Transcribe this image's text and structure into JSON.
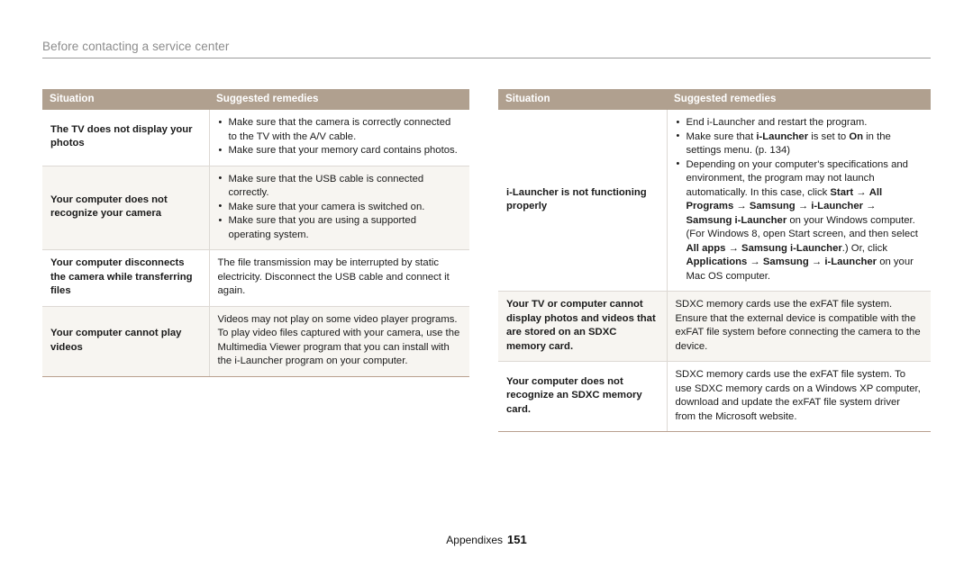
{
  "running_head": {
    "title": "Before contacting a service center"
  },
  "footer": {
    "section": "Appendixes",
    "page_number": "151"
  },
  "colors": {
    "table_header_bg": "#b0a08f",
    "table_header_text": "#ffffff",
    "row_shade": "#f7f5f1",
    "row_border": "#ddd9d4",
    "table_bottom_border": "#b99f8e",
    "running_head_text": "#8c8c8c",
    "running_head_rule": "#9a9a9a"
  },
  "tables": [
    {
      "id": "left",
      "columns": [
        "Situation",
        "Suggested remedies"
      ],
      "rows": [
        {
          "shaded": false,
          "situation": "The TV does not display your photos",
          "remedy_type": "bullets",
          "remedies": [
            "Make sure that the camera is correctly connected to the TV with the A/V cable.",
            "Make sure that your memory card contains photos."
          ]
        },
        {
          "shaded": true,
          "situation": "Your computer does not recognize your camera",
          "remedy_type": "bullets",
          "remedies": [
            "Make sure that the USB cable is connected correctly.",
            "Make sure that your camera is switched on.",
            "Make sure that you are using a supported operating system."
          ]
        },
        {
          "shaded": false,
          "situation": "Your computer disconnects the camera while transferring files",
          "remedy_type": "paragraph",
          "remedies": [
            "The file transmission may be interrupted by static electricity. Disconnect the USB cable and connect it again."
          ]
        },
        {
          "shaded": true,
          "situation": "Your computer cannot play videos",
          "remedy_type": "paragraph",
          "remedies": [
            "Videos may not play on some video player programs. To play video files captured with your camera, use the Multimedia Viewer program that you can install with the i-Launcher program on your computer."
          ]
        }
      ]
    },
    {
      "id": "right",
      "columns": [
        "Situation",
        "Suggested remedies"
      ],
      "rows": [
        {
          "shaded": false,
          "situation": "i-Launcher is not functioning properly",
          "remedy_type": "bullets_html",
          "remedies_html": [
            "End i-Launcher and restart the program.",
            "Make sure that <b>i-Launcher</b> is set to <b>On</b> in the settings menu. (p. 134)",
            "Depending on your computer's specifications and environment, the program may not launch automatically. In this case, click <b>Start</b> → <b>All Programs</b> → <b>Samsung</b> → <b>i-Launcher</b> → <b>Samsung i-Launcher</b> on your Windows computer. (For Windows 8, open Start screen, and then select <b>All apps</b> → <b>Samsung i-Launcher</b>.) Or, click <b>Applications</b> → <b>Samsung</b> → <b>i-Launcher</b> on your Mac OS computer."
          ]
        },
        {
          "shaded": true,
          "situation": "Your TV or computer cannot display photos and videos that are stored on an SDXC memory card.",
          "remedy_type": "paragraph",
          "remedies": [
            "SDXC memory cards use the exFAT file system. Ensure that the external device is compatible with the exFAT file system before connecting the camera to the device."
          ]
        },
        {
          "shaded": false,
          "situation": "Your computer does not recognize an SDXC memory card.",
          "remedy_type": "paragraph",
          "remedies": [
            "SDXC memory cards use the exFAT file system. To use SDXC memory cards on a Windows XP computer, download and update the exFAT file system driver from the Microsoft website."
          ]
        }
      ]
    }
  ]
}
